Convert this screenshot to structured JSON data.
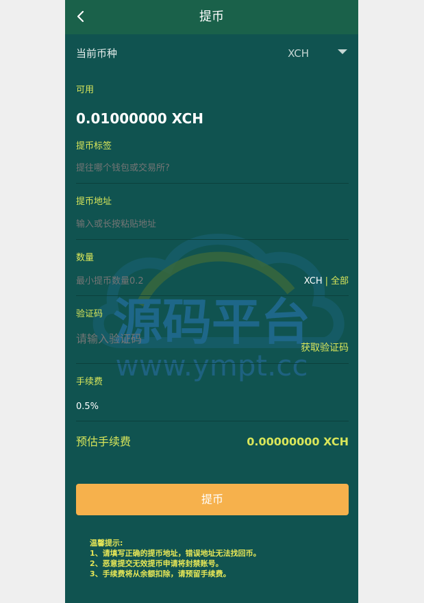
{
  "header": {
    "title": "提币"
  },
  "currency": {
    "label": "当前币种",
    "value": "XCH"
  },
  "available": {
    "label": "可用",
    "amount": "0.01000000 XCH"
  },
  "tag": {
    "label": "提币标签",
    "placeholder": "提往哪个钱包或交易所?"
  },
  "address": {
    "label": "提币地址",
    "placeholder": "输入或长按粘贴地址"
  },
  "quantity": {
    "label": "数量",
    "placeholder": "最小提币数量0.2",
    "unit": "XCH",
    "separator": "|",
    "all": "全部"
  },
  "verify": {
    "label": "验证码",
    "placeholder": "请输入验证码",
    "get_code": "获取验证码"
  },
  "fee": {
    "label": "手续费",
    "value": "0.5%"
  },
  "estimated": {
    "label": "预估手续费",
    "value": "0.00000000 XCH"
  },
  "submit": {
    "label": "提币"
  },
  "tips": {
    "title": "温馨提示:",
    "items": [
      "1、请填写正确的提币地址，错误地址无法找回币。",
      "2、恶意提交无效提币申请将封禁账号。",
      "3、手续费将从余额扣除，请预留手续费。"
    ]
  },
  "watermark": {
    "text": "源码平台",
    "url": "www.ympt.cc"
  },
  "colors": {
    "background": "#105350",
    "header": "#1a614a",
    "accent": "#d9e65a",
    "button": "#f6b14c"
  }
}
